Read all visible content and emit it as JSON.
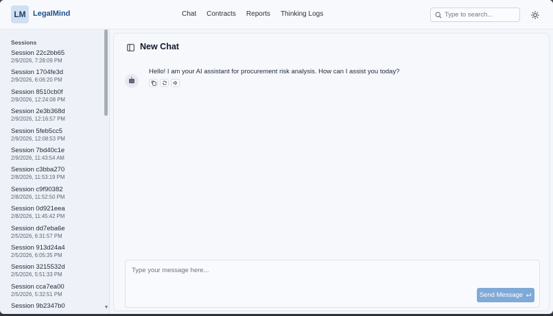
{
  "app": {
    "logo_badge": "LM",
    "logo_text": "LegalMind"
  },
  "nav": {
    "items": [
      "Chat",
      "Contracts",
      "Reports",
      "Thinking Logs"
    ]
  },
  "search": {
    "placeholder": "Type to search..."
  },
  "sidebar": {
    "heading": "Sessions",
    "sessions": [
      {
        "name": "Session 22c2bb65",
        "date": "2/9/2026, 7:28:09 PM"
      },
      {
        "name": "Session 1704fe3d",
        "date": "2/9/2026, 6:06:20 PM"
      },
      {
        "name": "Session 8510cb0f",
        "date": "2/9/2026, 12:24:08 PM"
      },
      {
        "name": "Session 2e3b368d",
        "date": "2/9/2026, 12:16:57 PM"
      },
      {
        "name": "Session 5feb5cc5",
        "date": "2/9/2026, 12:08:53 PM"
      },
      {
        "name": "Session 7bd40c1e",
        "date": "2/9/2026, 11:43:54 AM"
      },
      {
        "name": "Session c3bba270",
        "date": "2/8/2026, 11:53:19 PM"
      },
      {
        "name": "Session c9f90382",
        "date": "2/8/2026, 11:52:50 PM"
      },
      {
        "name": "Session 0d921eea",
        "date": "2/8/2026, 11:45:42 PM"
      },
      {
        "name": "Session dd7eba6e",
        "date": "2/5/2026, 6:31:57 PM"
      },
      {
        "name": "Session 913d24a4",
        "date": "2/5/2026, 6:05:35 PM"
      },
      {
        "name": "Session 3215532d",
        "date": "2/5/2026, 5:51:33 PM"
      },
      {
        "name": "Session cca7ea00",
        "date": "2/5/2026, 5:32:51 PM"
      },
      {
        "name": "Session 9b2347b0",
        "date": ""
      }
    ]
  },
  "chat": {
    "title": "New Chat",
    "messages": [
      {
        "role": "assistant",
        "text": "Hello! I am your AI assistant for procurement risk analysis. How can I assist you today?"
      }
    ],
    "composer_placeholder": "Type your message here...",
    "send_label": "Send Message",
    "send_icon": "enter-key-icon"
  },
  "colors": {
    "accent": "#1f4f8a",
    "send_button": "#7fa9d6",
    "logo_badge_bg": "#cfe0f3"
  }
}
